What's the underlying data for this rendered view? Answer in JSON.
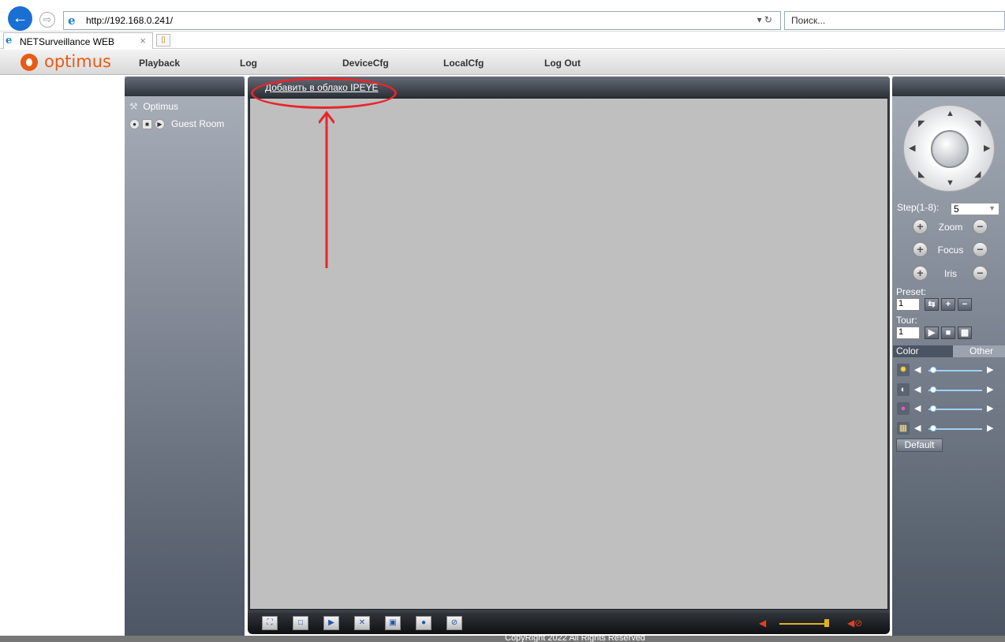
{
  "browser": {
    "url": "http://192.168.0.241/",
    "url_tools": "▾ ↻",
    "search_placeholder": "Поиск...",
    "tab_title": "NETSurveillance WEB",
    "tab_close": "×",
    "new_tab": "▯"
  },
  "app": {
    "logo_text": "optimus",
    "nav": [
      "Playback",
      "Log",
      "DeviceCfg",
      "LocalCfg",
      "Log Out"
    ]
  },
  "left_panel": {
    "device_name": "Optimus",
    "channel_name": "Guest Room"
  },
  "video": {
    "cloud_link": "Добавить в облако IPEYE"
  },
  "ptz": {
    "step_label": "Step(1-8):",
    "step_value": "5",
    "zoom_label": "Zoom",
    "focus_label": "Focus",
    "iris_label": "Iris",
    "preset_label": "Preset:",
    "preset_value": "1",
    "tour_label": "Tour:",
    "tour_value": "1",
    "tab_color": "Color",
    "tab_other": "Other",
    "default_label": "Default"
  },
  "footer": {
    "copyright": "CopyRight 2022 All Rights Reserved"
  },
  "annotation_color": "#e8262b",
  "accent_color": "#e85b14"
}
